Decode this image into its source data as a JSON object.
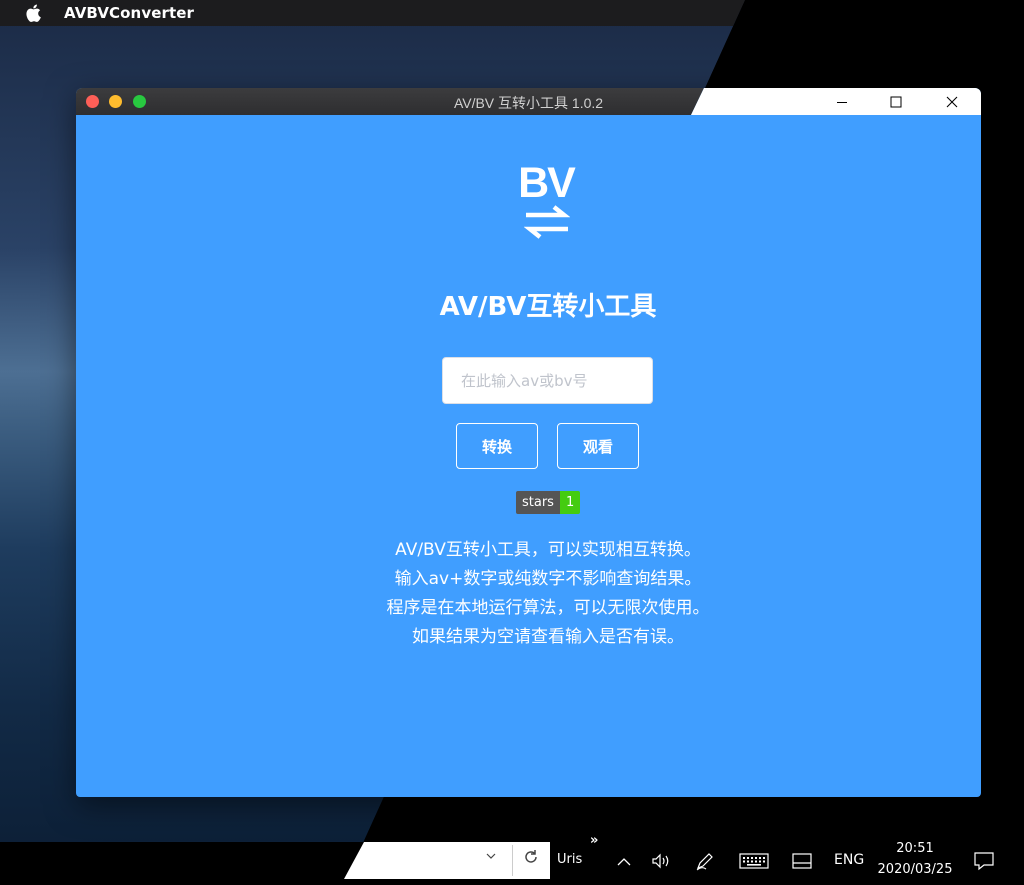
{
  "menubar": {
    "app_name": "AVBVConverter"
  },
  "window": {
    "title": "AV/BV 互转小工具 1.0.2"
  },
  "app": {
    "logo_text": "BV",
    "heading": "AV/BV互转小工具",
    "input_placeholder": "在此输入av或bv号",
    "input_value": "",
    "buttons": {
      "convert": "转换",
      "view": "观看"
    },
    "badge": {
      "label": "stars",
      "value": "1"
    },
    "description": [
      "AV/BV互转小工具，可以实现相互转换。",
      "输入av+数字或纯数字不影响查询结果。",
      "程序是在本地运行算法，可以无限次使用。",
      "如果结果为空请查看输入是否有误。"
    ]
  },
  "taskbar": {
    "address_value": "",
    "toolbar_label": "Uris",
    "more_label": "»",
    "language": "ENG",
    "time": "20:51",
    "date": "2020/03/25"
  },
  "colors": {
    "app_background": "#409eff",
    "badge_label_bg": "#555555",
    "badge_value_bg": "#44cc11",
    "mac_close": "#fe5f57",
    "mac_minimize": "#febc2e",
    "mac_maximize": "#28c840"
  },
  "icons": [
    "apple-icon",
    "swap-arrows-icon",
    "chevron-down-icon",
    "refresh-icon",
    "chevron-up-icon",
    "volume-icon",
    "pen-icon",
    "keyboard-icon",
    "tablet-mode-icon",
    "notification-icon"
  ]
}
